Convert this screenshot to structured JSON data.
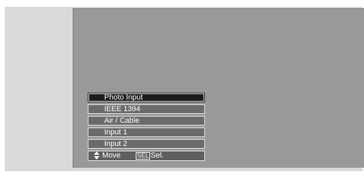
{
  "menu": {
    "items": [
      {
        "label": "Photo Input",
        "selected": true
      },
      {
        "label": "IEEE 1394",
        "selected": false
      },
      {
        "label": "Air / Cable",
        "selected": false
      },
      {
        "label": "Input 1",
        "selected": false
      },
      {
        "label": "Input 2",
        "selected": false
      }
    ],
    "footer": {
      "move_icon": "up-down-arrows-icon",
      "move_label": "Move",
      "sel_key": "SEL",
      "sel_label": "Sel."
    }
  },
  "colors": {
    "screen": "#999999",
    "item_background": "#6b6b6b",
    "selected_background": "#1c1c1c",
    "text": "#ffffff"
  }
}
